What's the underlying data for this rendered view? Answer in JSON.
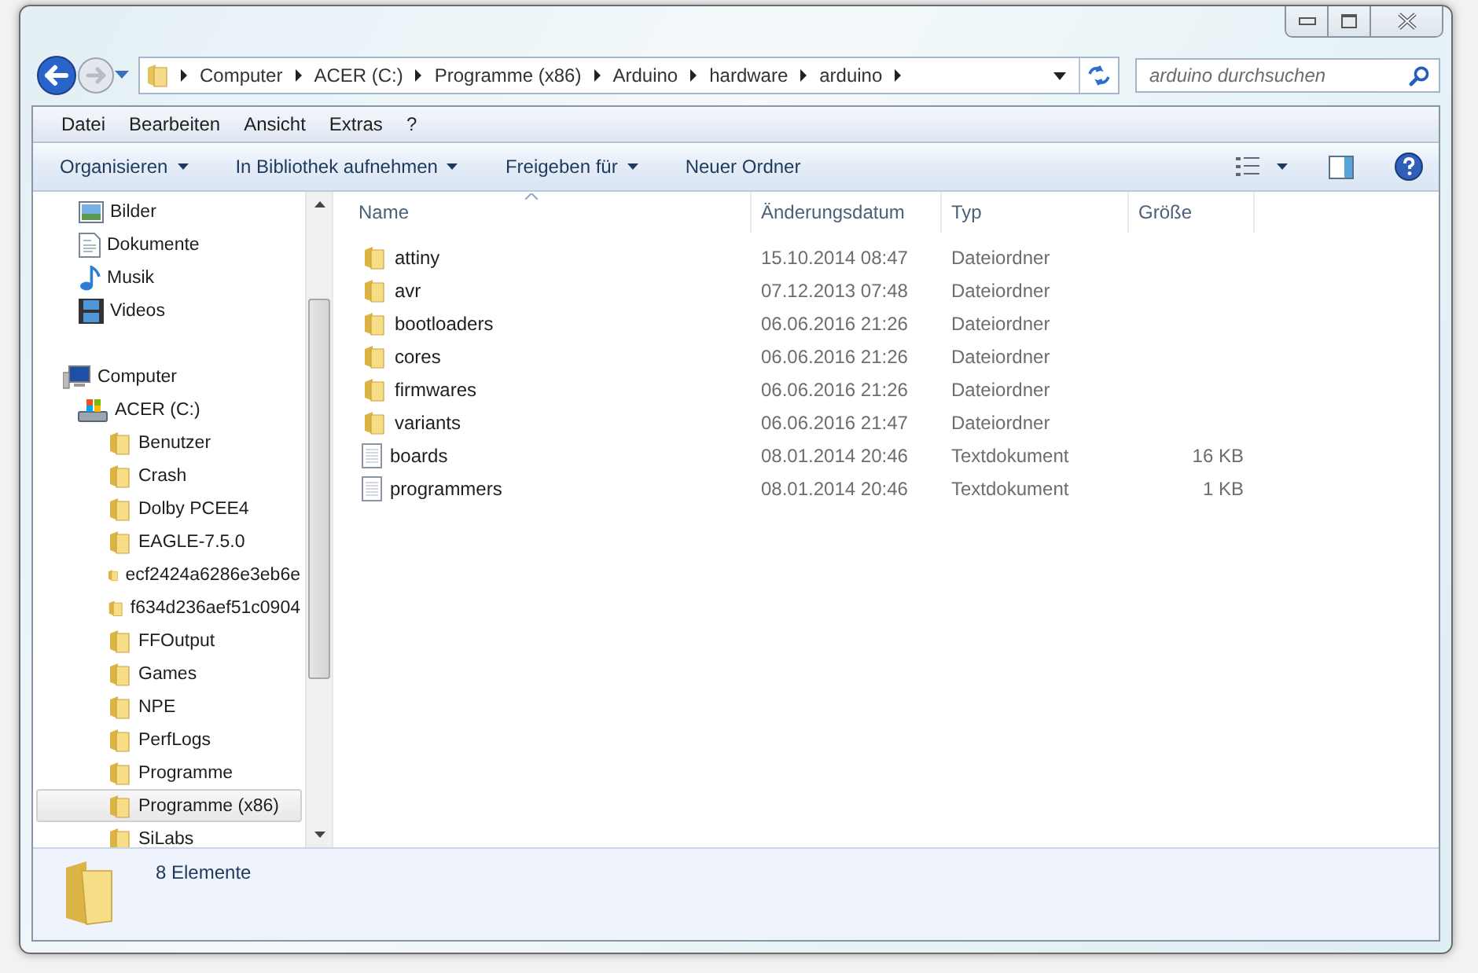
{
  "address_bar": {
    "crumbs": [
      "Computer",
      "ACER (C:)",
      "Programme (x86)",
      "Arduino",
      "hardware",
      "arduino"
    ]
  },
  "search": {
    "placeholder": "arduino durchsuchen"
  },
  "menu_bar": [
    "Datei",
    "Bearbeiten",
    "Ansicht",
    "Extras",
    "?"
  ],
  "toolbar": [
    {
      "label": "Organisieren",
      "dropdown": true
    },
    {
      "label": "In Bibliothek aufnehmen",
      "dropdown": true
    },
    {
      "label": "Freigeben für",
      "dropdown": true
    },
    {
      "label": "Neuer Ordner",
      "dropdown": false
    }
  ],
  "sidebar": {
    "items": [
      {
        "label": "Bilder",
        "kind": "pictures",
        "selected": false
      },
      {
        "label": "Dokumente",
        "kind": "documents",
        "selected": false
      },
      {
        "label": "Musik",
        "kind": "music",
        "selected": false
      },
      {
        "label": "Videos",
        "kind": "videos",
        "selected": false
      },
      {
        "label": "Computer",
        "kind": "computer",
        "selected": false,
        "children": [
          {
            "label": "ACER (C:)",
            "kind": "drive",
            "selected": false,
            "children": [
              {
                "label": "Benutzer",
                "kind": "folder",
                "selected": false
              },
              {
                "label": "Crash",
                "kind": "folder",
                "selected": false
              },
              {
                "label": "Dolby PCEE4",
                "kind": "folder",
                "selected": false
              },
              {
                "label": "EAGLE-7.5.0",
                "kind": "folder",
                "selected": false
              },
              {
                "label": "ecf2424a6286e3eb6e",
                "kind": "folder",
                "selected": false
              },
              {
                "label": "f634d236aef51c0904",
                "kind": "folder",
                "selected": false
              },
              {
                "label": "FFOutput",
                "kind": "folder",
                "selected": false
              },
              {
                "label": "Games",
                "kind": "folder",
                "selected": false
              },
              {
                "label": "NPE",
                "kind": "folder",
                "selected": false
              },
              {
                "label": "PerfLogs",
                "kind": "folder",
                "selected": false
              },
              {
                "label": "Programme",
                "kind": "folder",
                "selected": false
              },
              {
                "label": "Programme (x86)",
                "kind": "folder",
                "selected": true
              },
              {
                "label": "SiLabs",
                "kind": "folder",
                "selected": false
              }
            ]
          }
        ]
      }
    ]
  },
  "table": {
    "columns": [
      "Name",
      "Änderungsdatum",
      "Typ",
      "Größe"
    ],
    "rows": [
      {
        "kind": "folder",
        "name": "attiny",
        "date": "15.10.2014 08:47",
        "type": "Dateiordner"
      },
      {
        "kind": "folder",
        "name": "avr",
        "date": "07.12.2013 07:48",
        "type": "Dateiordner"
      },
      {
        "kind": "folder",
        "name": "bootloaders",
        "date": "06.06.2016 21:26",
        "type": "Dateiordner"
      },
      {
        "kind": "folder",
        "name": "cores",
        "date": "06.06.2016 21:26",
        "type": "Dateiordner"
      },
      {
        "kind": "folder",
        "name": "firmwares",
        "date": "06.06.2016 21:26",
        "type": "Dateiordner"
      },
      {
        "kind": "folder",
        "name": "variants",
        "date": "06.06.2016 21:47",
        "type": "Dateiordner"
      },
      {
        "kind": "file",
        "name": "boards",
        "date": "08.01.2014 20:46",
        "type": "Textdokument",
        "size": "16 KB"
      },
      {
        "kind": "file",
        "name": "programmers",
        "date": "08.01.2014 20:46",
        "type": "Textdokument",
        "size": "1 KB"
      }
    ]
  },
  "status_bar": {
    "count": "8 Elemente"
  }
}
